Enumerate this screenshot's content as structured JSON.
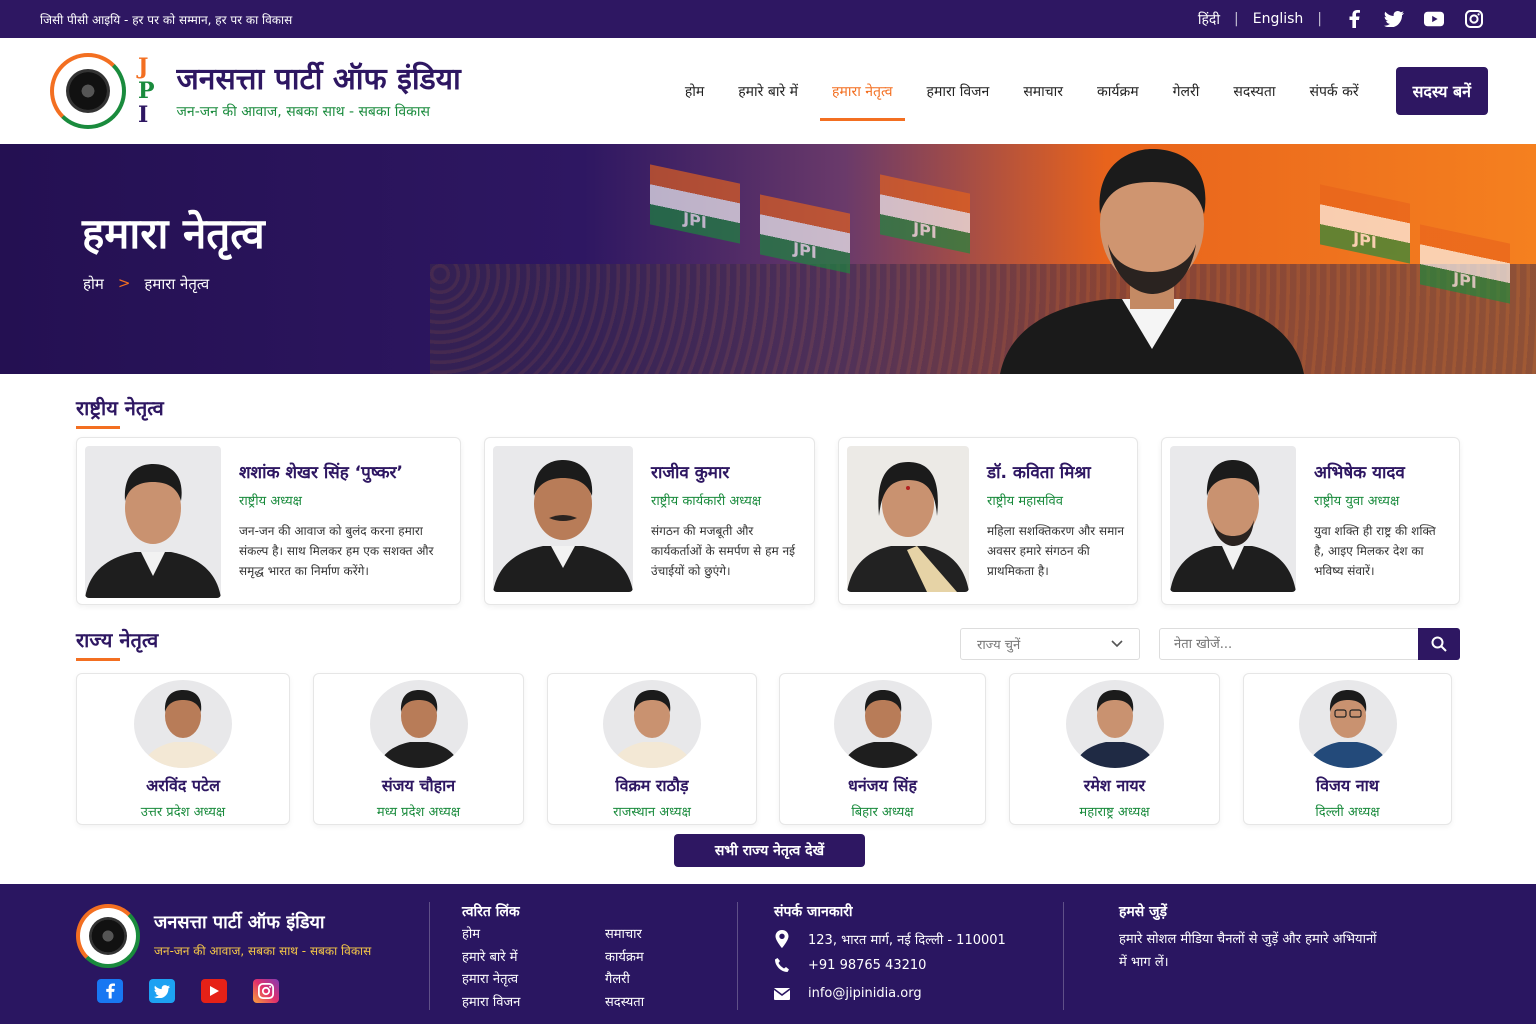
{
  "topbar": {
    "tagline": "जिसी पीसी आइयि - हर पर को सम्मान, हर पर का विकास",
    "lang_hi": "हिंदी",
    "lang_en": "English",
    "social": [
      "facebook-icon",
      "twitter-icon",
      "youtube-icon",
      "instagram-icon"
    ]
  },
  "brand": {
    "logo_letters": [
      "J",
      "P",
      "I"
    ],
    "title": "जनसत्ता पार्टी ऑफ इंडिया",
    "tagline": "जन-जन की आवाज, सबका साथ - सबका विकास"
  },
  "nav": {
    "items": [
      "होम",
      "हमारे बारे में",
      "हमारा नेतृत्व",
      "हमारा विजन",
      "समाचार",
      "कार्यक्रम",
      "गेलरी",
      "सदस्यता",
      "संपर्क करें"
    ],
    "active": "हमारा नेतृत्व",
    "cta": "सदस्य बनें"
  },
  "hero": {
    "title": "हमारा नेतृत्व",
    "breadcrumb_home": "होम",
    "breadcrumb_sep": ">",
    "breadcrumb_current": "हमारा नेतृत्व",
    "flag_text": "JPI"
  },
  "national": {
    "title": "राष्ट्रीय नेतृत्व",
    "leaders": [
      {
        "name": "शशांक शेखर सिंह ‘पुष्कर’",
        "role": "राष्ट्रीय अध्यक्ष",
        "desc": "जन-जन की आवाज को बुलंद करना हमारा संकल्प है। साथ मिलकर हम एक सशक्त और समृद्ध भारत का निर्माण करेंगे।"
      },
      {
        "name": "राजीव कुमार",
        "role": "राष्ट्रीय कार्यकारी अध्यक्ष",
        "desc": "संगठन की मजबूती और कार्यकर्ताओं के समर्पण से हम नई उंचाईयों को छुएंगे।"
      },
      {
        "name": "डॉ. कविता मिश्रा",
        "role": "राष्ट्रीय महासविव",
        "desc": "महिला सशक्तिकरण और समान अवसर हमारे संगठन की प्राथमिकता है।"
      },
      {
        "name": "अभिषेक यादव",
        "role": "राष्ट्रीय युवा अध्यक्ष",
        "desc": "युवा शक्ति ही राष्ट्र की शक्ति है, आइए मिलकर देश का भविष्य संवारें।"
      }
    ]
  },
  "state": {
    "title": "राज्य नेतृत्व",
    "select_placeholder": "राज्य चुनें",
    "search_placeholder": "नेता खोजें...",
    "leaders": [
      {
        "name": "अरविंद पटेल",
        "role": "उत्तर प्रदेश अध्यक्ष"
      },
      {
        "name": "संजय चौहान",
        "role": "मध्य प्रदेश अध्यक्ष"
      },
      {
        "name": "विक्रम राठौड़",
        "role": "राजस्थान अध्यक्ष"
      },
      {
        "name": "धनंजय सिंह",
        "role": "बिहार अध्यक्ष"
      },
      {
        "name": "रमेश नायर",
        "role": "महाराष्ट्र अध्यक्ष"
      },
      {
        "name": "विजय नाथ",
        "role": "दिल्ली अध्यक्ष"
      }
    ],
    "view_all": "सभी राज्य नेतृत्व देखें"
  },
  "footer": {
    "title": "जनसत्ता पार्टी ऑफ इंडिया",
    "tagline": "जन-जन की आवाज, सबका साथ - सबका विकास",
    "quick_title": "त्वरित लिंक",
    "quick_col1": [
      "होम",
      "हमारे बारे में",
      "हमारा नेतृत्व",
      "हमारा विजन"
    ],
    "quick_col2": [
      "समाचार",
      "कार्यक्रम",
      "गैलरी",
      "सदस्यता"
    ],
    "contact_title": "संपर्क जानकारी",
    "address": "123, भारत मार्ग, नई दिल्ली - 110001",
    "phone": "+91 98765 43210",
    "email": "info@jipinidia.org",
    "connect_title": "हमसे जुड़ें",
    "connect_text": "हमारे सोशल मीडिया चैनलों से जुड़ें और हमारे अभियानों में भाग लें।"
  },
  "colors": {
    "primary": "#2e1762",
    "accent": "#f36f21",
    "green": "#1a8b3d"
  }
}
